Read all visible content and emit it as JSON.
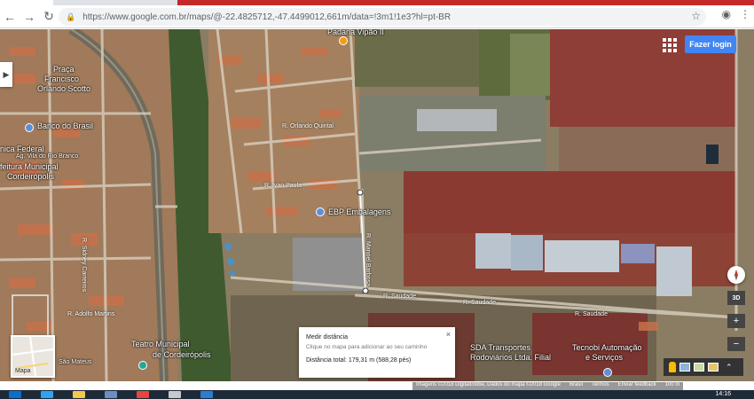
{
  "browser": {
    "url": "https://www.google.com.br/maps/@-22.4825712,-47.4499012,661m/data=!3m1!1e3?hl=pt-BR",
    "back_icon": "arrow-left-icon",
    "forward_icon": "arrow-right-icon",
    "reload_icon": "reload-icon",
    "lock_icon": "lock-icon",
    "bookmark_icon": "star-icon"
  },
  "map": {
    "places": {
      "praca": "Praça",
      "francisco": "Francisco",
      "orlando_scotto": "Orlando Scotto",
      "banco_brasil": "Banco do Brasil",
      "unica_federal": "nica Federal",
      "ag_vila": "Ag. Vila do Rio Branco",
      "feitura_municipal": "feitura Municipal",
      "cordeiropolis": "Cordeirópolis",
      "ebp": "EBP Embalagens",
      "padaria": "Padaria Vipão II",
      "teatro": "Teatro Municipal",
      "teatro2": "de Cordeirópolis",
      "sda": "SDA Transportes",
      "sda2": "Rodoviários Ltda. Filial",
      "tecnobi": "Tecnobi Automação",
      "tecnobi2": "e Serviços",
      "sao_mateus": "São Mateus"
    },
    "roads": {
      "saudade_1": "R. Saudade",
      "saudade_2": "R. Saudade",
      "saudade_3": "R. Saudade",
      "adolfo": "R. Adolfo Martins",
      "floriano": "R. Sidney Carreiros",
      "orlando": "R. Orlando Quintal",
      "ivan": "R. Ivan Paula",
      "ribeiro": "R. Manoel Barbosa"
    },
    "login_label": "Fazer login",
    "minimap_label": "Mapa",
    "measure": {
      "title": "Medir distância",
      "hint": "Clique no mapa para adicionar ao seu caminho",
      "total": "Distância total: 179,31 m (588,28 pés)",
      "close": "×"
    },
    "controls": {
      "three_d": "3D",
      "zoom_in": "+",
      "zoom_out": "−",
      "expand": "⌃"
    },
    "attribution": {
      "imagery": "Imagens ©2018 DigitalGlobe, Dados do mapa ©2018 Google",
      "country": "Brasil",
      "terms": "Termos",
      "feedback": "Enviar feedback",
      "scale": "100 m"
    }
  },
  "taskbar": {
    "clock": "14:16"
  }
}
